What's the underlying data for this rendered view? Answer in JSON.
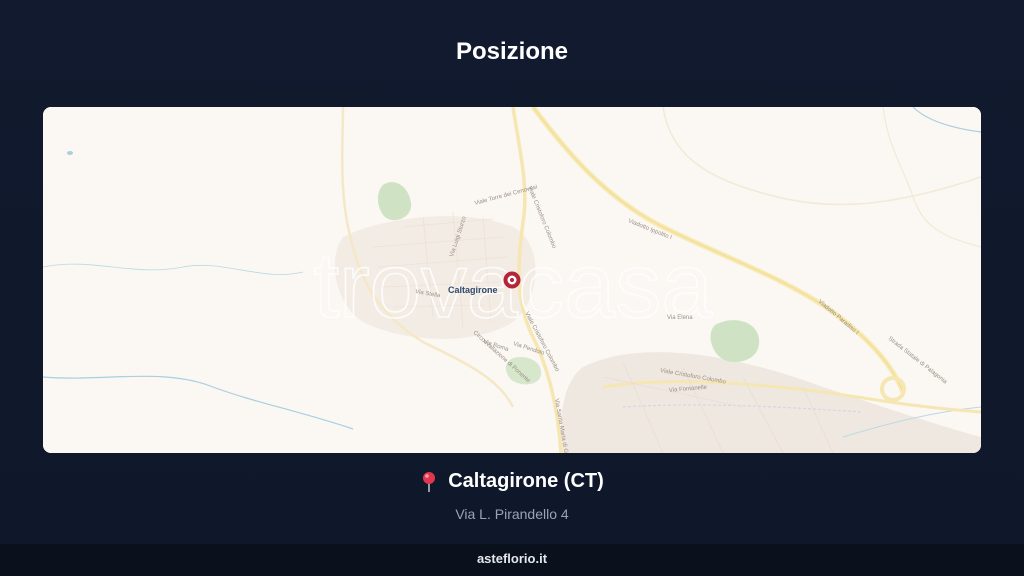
{
  "page": {
    "title": "Posizione"
  },
  "map": {
    "city_label": "Caltagirone",
    "watermark": "trovacasa",
    "streets": [
      "Viale Torre dei Cenovesi",
      "Viale Cristoforo Colombo",
      "Viadotto Ippolito I",
      "Via Luigi Sturzo",
      "Via Stella",
      "Viale Cristoforo Colombo",
      "Via Roma",
      "Via Pendolo",
      "Circonvallazione di Ponente",
      "Via Elena",
      "Viadotto Paradiso I",
      "Strada Statale di Palagonia",
      "Viale Cristoforo Colombo",
      "Via Fontanelle",
      "Via Santa Maria di Gesù"
    ]
  },
  "location": {
    "pin_icon": "round-pushpin-icon",
    "title": "Caltagirone (CT)",
    "address": "Via L. Pirandello 4"
  },
  "footer": {
    "site": "asteflorio.it"
  }
}
